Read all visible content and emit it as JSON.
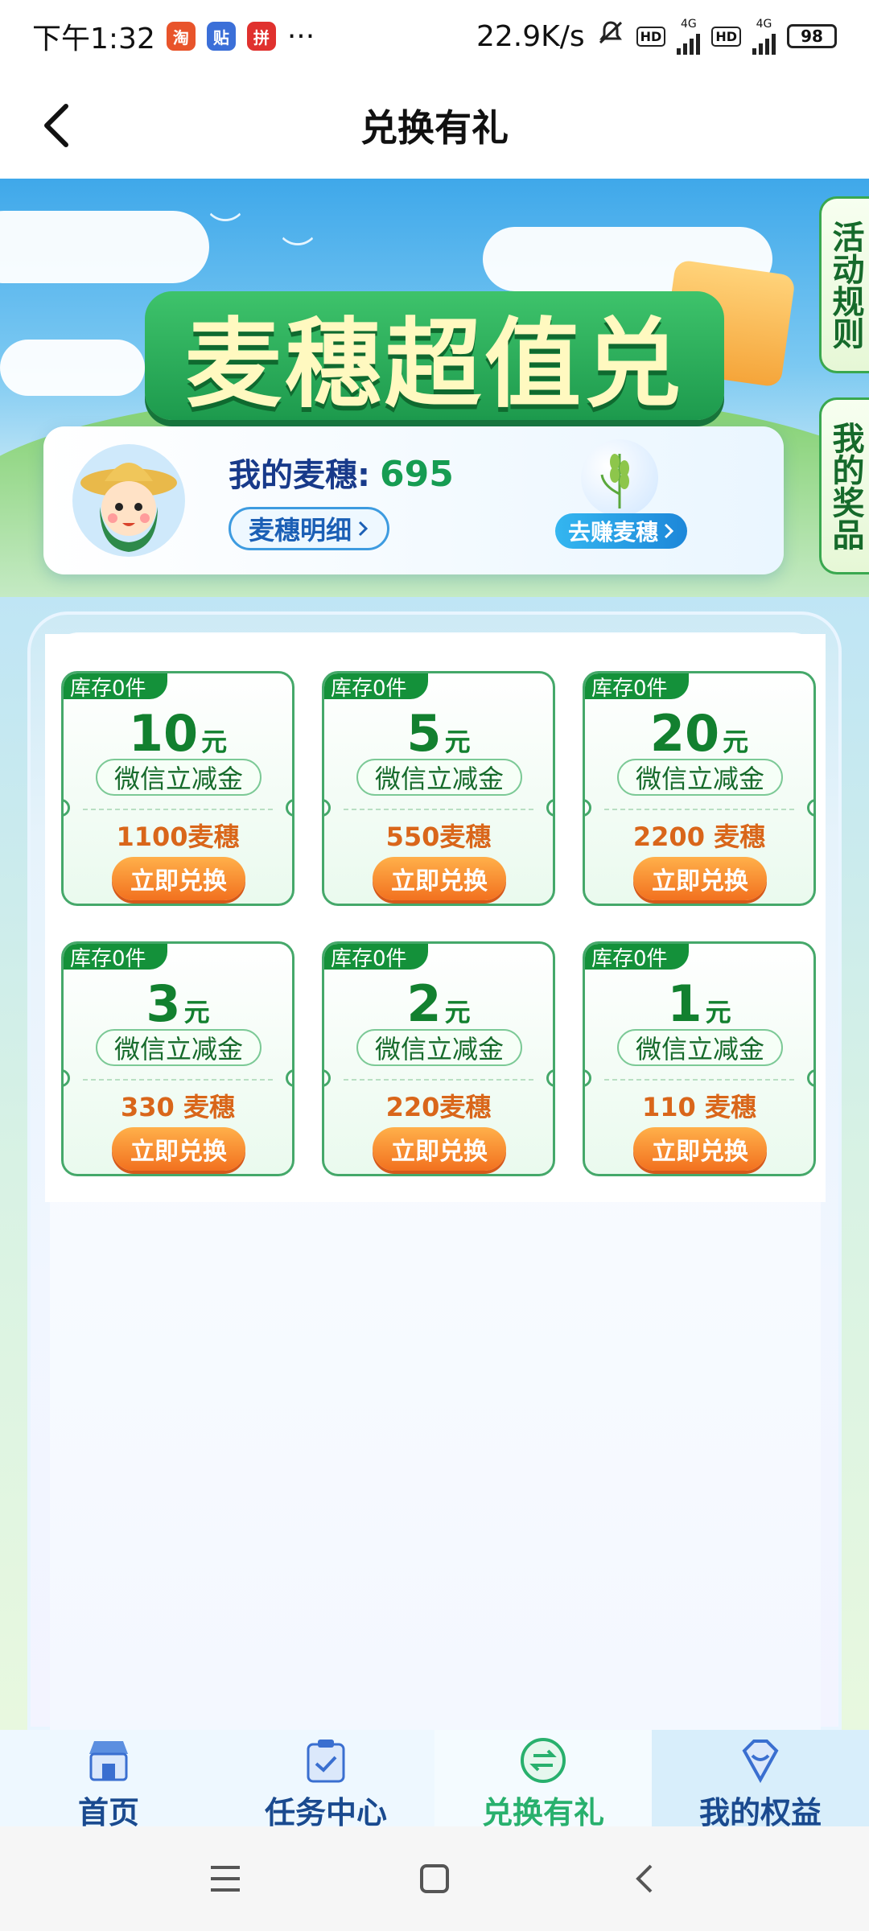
{
  "status_bar": {
    "time": "下午1:32",
    "app_icons": [
      "淘",
      "贴",
      "拼"
    ],
    "more": "···",
    "net_speed": "22.9K/s",
    "hd1": "HD",
    "hd2": "HD",
    "net_type1": "4G",
    "net_type2": "4G",
    "battery": "98"
  },
  "header": {
    "title": "兑换有礼"
  },
  "hero": {
    "title": "麦穗超值兑",
    "my_wheat_label": "我的麦穗:",
    "my_wheat_value": "695",
    "detail_button": "麦穗明细",
    "earn_button": "去赚麦穗",
    "side_tab_rules": "活动规则",
    "side_tab_prizes": "我的奖品"
  },
  "coupons": [
    {
      "stock": "库存0件",
      "amount": "10",
      "unit": "元",
      "type": "微信立减金",
      "cost": "1100麦穗",
      "button": "立即兑换"
    },
    {
      "stock": "库存0件",
      "amount": "5",
      "unit": "元",
      "type": "微信立减金",
      "cost": "550麦穗",
      "button": "立即兑换"
    },
    {
      "stock": "库存0件",
      "amount": "20",
      "unit": "元",
      "type": "微信立减金",
      "cost": "2200 麦穗",
      "button": "立即兑换"
    },
    {
      "stock": "库存0件",
      "amount": "3",
      "unit": "元",
      "type": "微信立减金",
      "cost": "330 麦穗",
      "button": "立即兑换"
    },
    {
      "stock": "库存0件",
      "amount": "2",
      "unit": "元",
      "type": "微信立减金",
      "cost": "220麦穗",
      "button": "立即兑换"
    },
    {
      "stock": "库存0件",
      "amount": "1",
      "unit": "元",
      "type": "微信立减金",
      "cost": "110 麦穗",
      "button": "立即兑换"
    }
  ],
  "bottom_nav": [
    {
      "label": "首页",
      "icon": "store-icon"
    },
    {
      "label": "任务中心",
      "icon": "task-icon"
    },
    {
      "label": "兑换有礼",
      "icon": "exchange-icon",
      "active": true
    },
    {
      "label": "我的权益",
      "icon": "benefits-icon"
    }
  ],
  "colors": {
    "primary_green": "#14913a",
    "orange": "#f2711f",
    "nav_blue": "#1a4a8f",
    "active_green": "#28b06d"
  }
}
